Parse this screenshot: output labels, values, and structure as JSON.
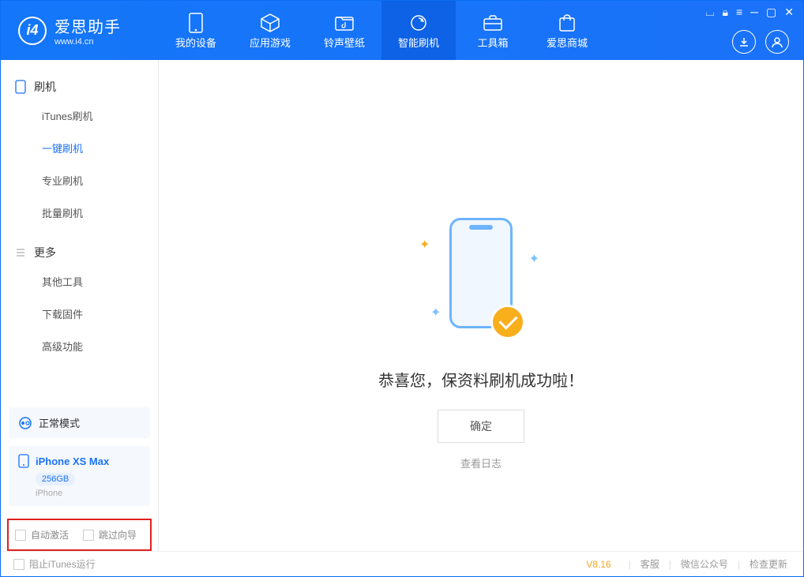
{
  "brand": {
    "name": "爱思助手",
    "url": "www.i4.cn"
  },
  "tabs": [
    {
      "label": "我的设备"
    },
    {
      "label": "应用游戏"
    },
    {
      "label": "铃声壁纸"
    },
    {
      "label": "智能刷机"
    },
    {
      "label": "工具箱"
    },
    {
      "label": "爱思商城"
    }
  ],
  "sidebar": {
    "group1": {
      "title": "刷机",
      "items": [
        "iTunes刷机",
        "一键刷机",
        "专业刷机",
        "批量刷机"
      ]
    },
    "group2": {
      "title": "更多",
      "items": [
        "其他工具",
        "下载固件",
        "高级功能"
      ]
    }
  },
  "device": {
    "mode": "正常模式",
    "name": "iPhone XS Max",
    "storage": "256GB",
    "type": "iPhone"
  },
  "options": {
    "auto_activate": "自动激活",
    "skip_guide": "跳过向导"
  },
  "main": {
    "success": "恭喜您，保资料刷机成功啦！",
    "confirm": "确定",
    "view_log": "查看日志"
  },
  "footer": {
    "block_itunes": "阻止iTunes运行",
    "version": "V8.16",
    "links": [
      "客服",
      "微信公众号",
      "检查更新"
    ]
  }
}
